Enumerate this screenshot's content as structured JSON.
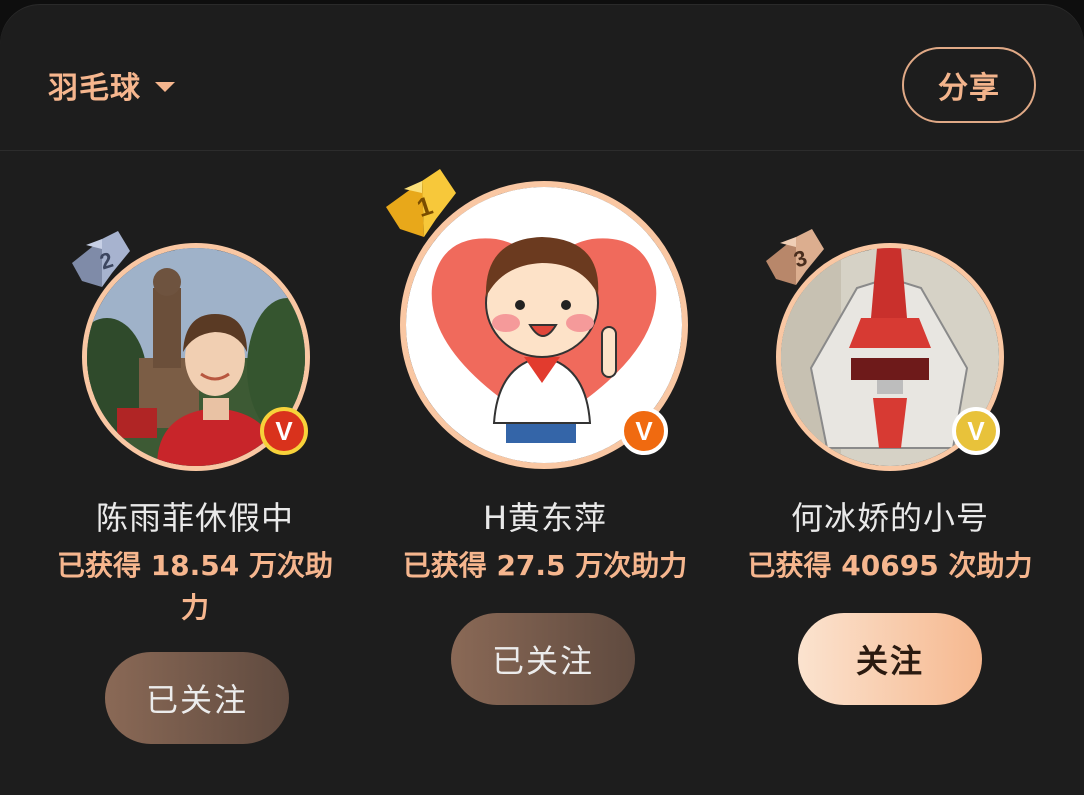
{
  "header": {
    "category_label": "羽毛球",
    "share_label": "分享"
  },
  "ranking": [
    {
      "rank": "2",
      "name": "陈雨菲休假中",
      "support_line1": "已获得 18.54 万次助",
      "support_line2": "力",
      "button_label": "已关注",
      "verified_color": "#d9321c",
      "followed": true
    },
    {
      "rank": "1",
      "name": "H黄东萍",
      "support_line1": "已获得 27.5 万次助力",
      "button_label": "已关注",
      "verified_color": "#f06a10",
      "followed": true
    },
    {
      "rank": "3",
      "name": "何冰娇的小号",
      "support_line1": "已获得 40695 次助力",
      "button_label": "关注",
      "verified_color": "#e8c23a",
      "followed": false
    }
  ],
  "colors": {
    "accent": "#f6b68e",
    "background": "#1d1d1d",
    "gold": "#f3c12a",
    "silver": "#9aa7c2",
    "bronze": "#d9a98a"
  }
}
